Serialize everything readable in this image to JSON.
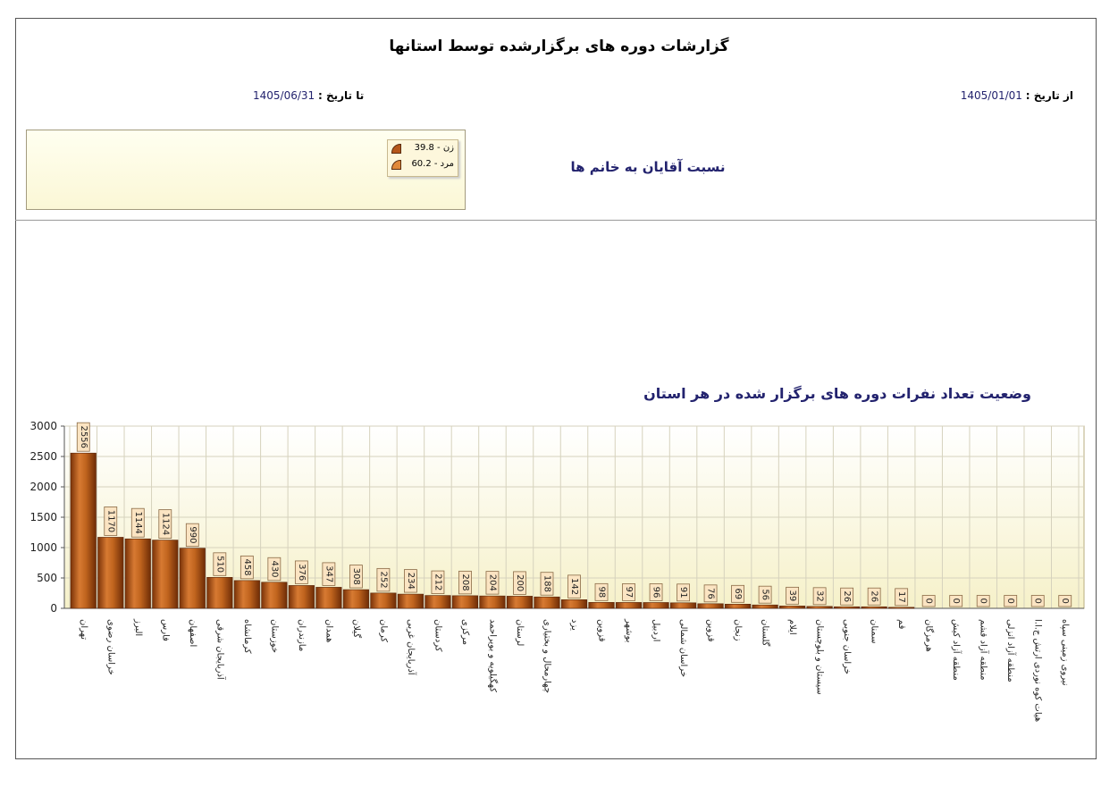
{
  "report": {
    "title": "گزارشات  دوره های برگزارشده توسط استانها",
    "from_label": "از تاریخ :",
    "from_value": "1405/01/01",
    "to_label": "تا تاریخ :",
    "to_value": "1405/06/31"
  },
  "pie": {
    "title": "نسبت آقایان به خانم ها",
    "legend": [
      {
        "label": "زن - 39.8",
        "color": "#b5561a"
      },
      {
        "label": "مرد - 60.2",
        "color": "#e0893a"
      }
    ]
  },
  "chart_title": "وضعیت تعداد نفرات دوره های برگزار شده در هر استان",
  "chart_data": {
    "type": "bar",
    "title": "وضعیت تعداد نفرات دوره های برگزار شده در هر استان",
    "ylim": [
      0,
      3000
    ],
    "yticks": [
      0,
      500,
      1000,
      1500,
      2000,
      2500,
      3000
    ],
    "grid": true,
    "categories": [
      "تهران",
      "خراسان رضوی",
      "البرز",
      "فارس",
      "اصفهان",
      "آذربایجان شرقی",
      "کرمانشاه",
      "خوزستان",
      "مازندران",
      "همدان",
      "گیلان",
      "کرمان",
      "آذربایجان غربی",
      "کردستان",
      "مرکزی",
      "کهگیلویه و بویراحمد",
      "لرستان",
      "چهارمحال و بختیاری",
      "یزد",
      "قزوین",
      "بوشهر",
      "اردبیل",
      "خراسان شمالی",
      "قزوین",
      "زنجان",
      "گلستان",
      "ایلام",
      "سیستان و بلوچستان",
      "خراسان جنوبی",
      "سمنان",
      "قم",
      "هرمزگان",
      "منطقه آزاد کیش",
      "منطقه آزاد قشم",
      "منطقه آزاد انزلی",
      "هیات کوه نوردی ارتش ج.ا.ا",
      "نیروی زمینی سپاه"
    ],
    "values": [
      2556,
      1170,
      1144,
      1124,
      990,
      510,
      458,
      430,
      376,
      347,
      308,
      252,
      234,
      212,
      208,
      204,
      200,
      188,
      142,
      98,
      97,
      96,
      91,
      76,
      69,
      56,
      39,
      32,
      26,
      26,
      17,
      0,
      0,
      0,
      0,
      0,
      0
    ]
  }
}
